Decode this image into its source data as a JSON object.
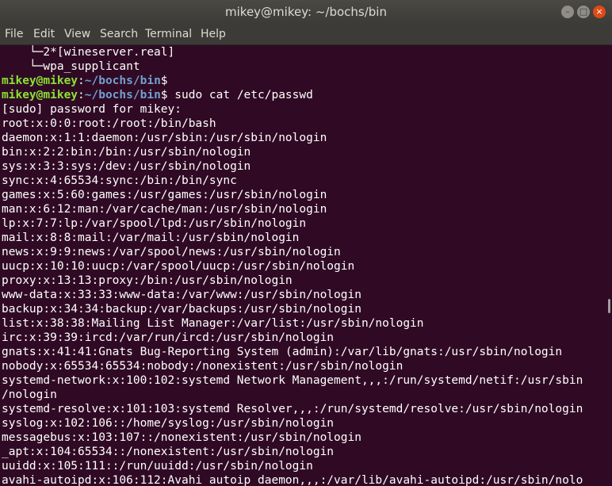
{
  "window": {
    "title": "mikey@mikey: ~/bochs/bin",
    "minimize": "–",
    "maximize": "□",
    "close": "×"
  },
  "menu": [
    "File",
    "Edit",
    "View",
    "Search",
    "Terminal",
    "Help"
  ],
  "terminal": {
    "tree_lines": [
      "    └─2*[wineserver.real]",
      "    └─wpa_supplicant"
    ],
    "prompt_user": "mikey@mikey",
    "prompt_path": "~/bochs/bin",
    "prompt_1_cmd": "",
    "prompt_2_cmd": " sudo cat /etc/passwd",
    "output": [
      "[sudo] password for mikey:",
      "root:x:0:0:root:/root:/bin/bash",
      "daemon:x:1:1:daemon:/usr/sbin:/usr/sbin/nologin",
      "bin:x:2:2:bin:/bin:/usr/sbin/nologin",
      "sys:x:3:3:sys:/dev:/usr/sbin/nologin",
      "sync:x:4:65534:sync:/bin:/bin/sync",
      "games:x:5:60:games:/usr/games:/usr/sbin/nologin",
      "man:x:6:12:man:/var/cache/man:/usr/sbin/nologin",
      "lp:x:7:7:lp:/var/spool/lpd:/usr/sbin/nologin",
      "mail:x:8:8:mail:/var/mail:/usr/sbin/nologin",
      "news:x:9:9:news:/var/spool/news:/usr/sbin/nologin",
      "uucp:x:10:10:uucp:/var/spool/uucp:/usr/sbin/nologin",
      "proxy:x:13:13:proxy:/bin:/usr/sbin/nologin",
      "www-data:x:33:33:www-data:/var/www:/usr/sbin/nologin",
      "backup:x:34:34:backup:/var/backups:/usr/sbin/nologin",
      "list:x:38:38:Mailing List Manager:/var/list:/usr/sbin/nologin",
      "irc:x:39:39:ircd:/var/run/ircd:/usr/sbin/nologin",
      "gnats:x:41:41:Gnats Bug-Reporting System (admin):/var/lib/gnats:/usr/sbin/nologin",
      "nobody:x:65534:65534:nobody:/nonexistent:/usr/sbin/nologin",
      "systemd-network:x:100:102:systemd Network Management,,,:/run/systemd/netif:/usr/sbin",
      "/nologin",
      "systemd-resolve:x:101:103:systemd Resolver,,,:/run/systemd/resolve:/usr/sbin/nologin",
      "syslog:x:102:106::/home/syslog:/usr/sbin/nologin",
      "messagebus:x:103:107::/nonexistent:/usr/sbin/nologin",
      "_apt:x:104:65534::/nonexistent:/usr/sbin/nologin",
      "uuidd:x:105:111::/run/uuidd:/usr/sbin/nologin",
      "avahi-autoipd:x:106:112:Avahi autoip daemon,,,:/var/lib/avahi-autoipd:/usr/sbin/nolo"
    ]
  },
  "colors": {
    "background": "#300a24",
    "prompt_user": "#8ae234",
    "prompt_path": "#729fcf"
  }
}
